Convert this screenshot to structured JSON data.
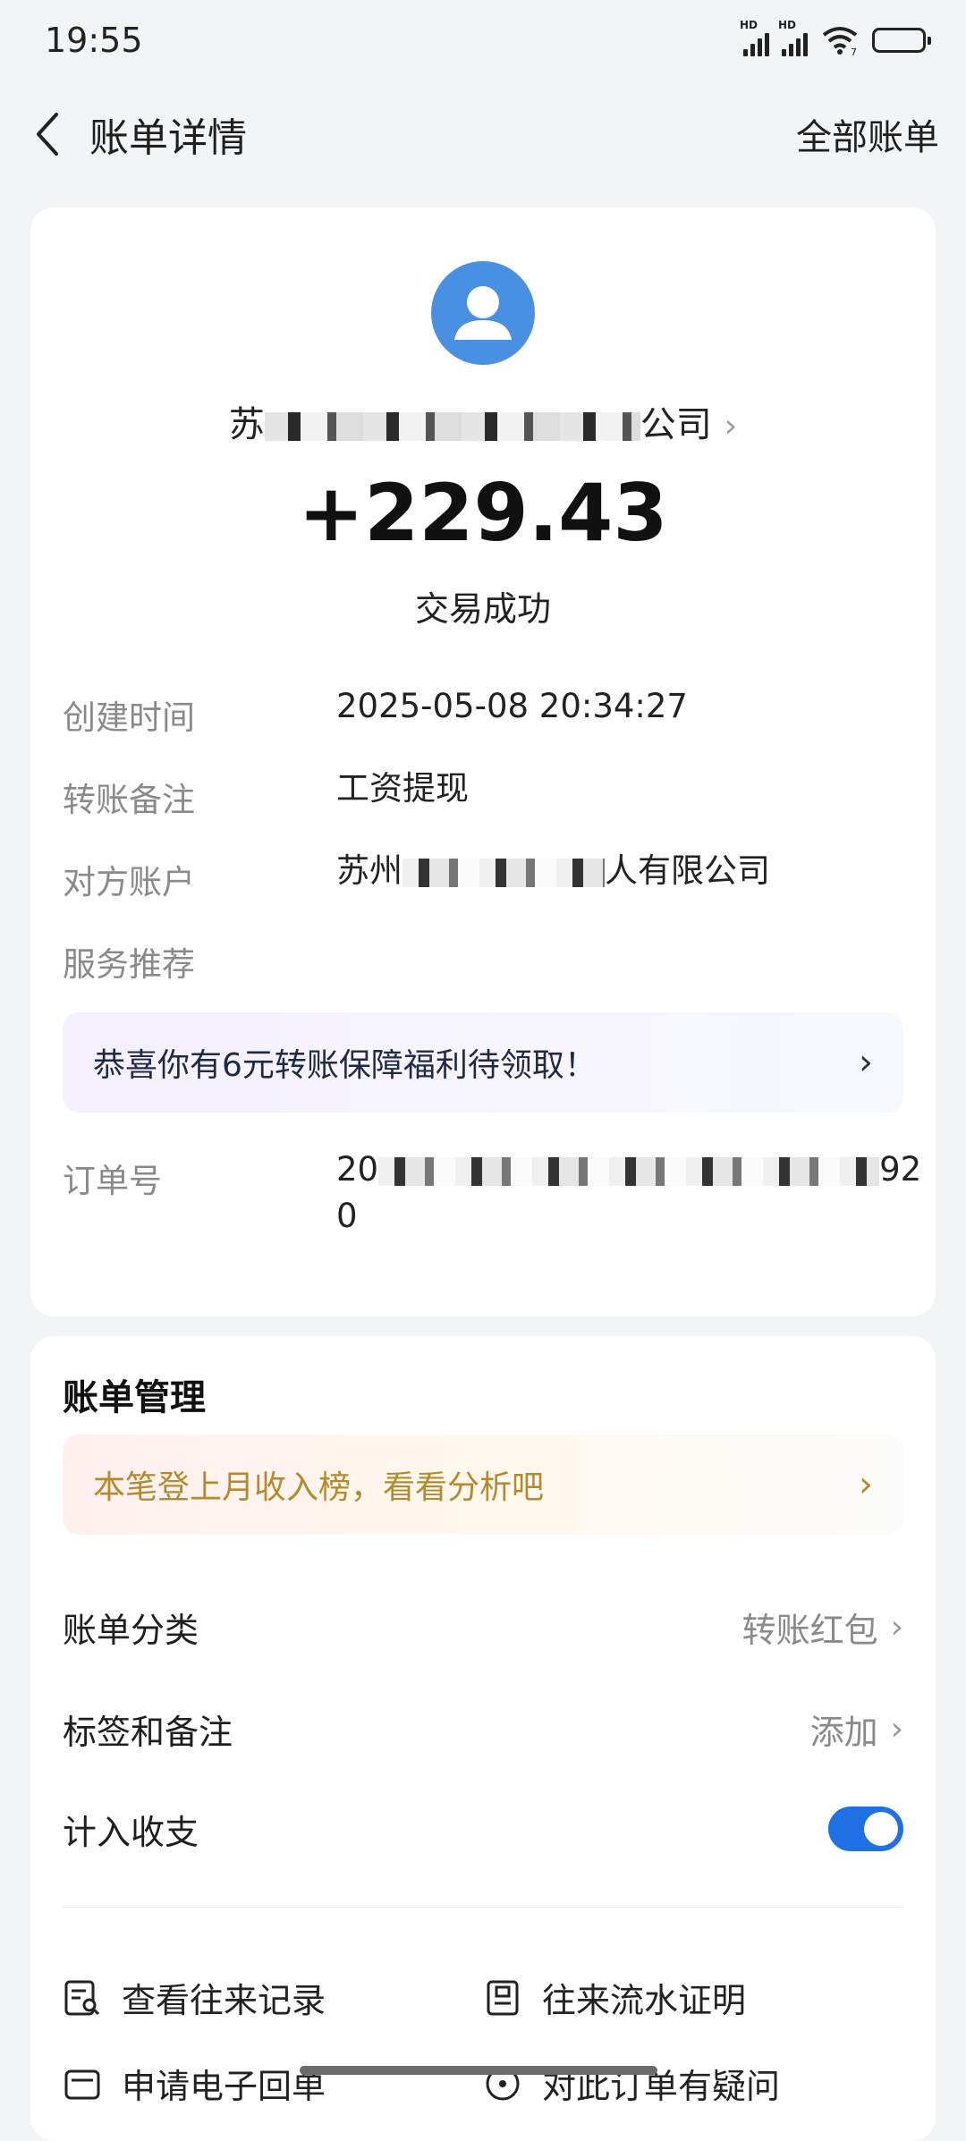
{
  "status_bar": {
    "time": "19:55",
    "signal1_label": "HD",
    "signal2_label": "HD",
    "wifi_badge": "7"
  },
  "nav": {
    "title": "账单详情",
    "right_link": "全部账单"
  },
  "transaction": {
    "counterparty_prefix": "苏",
    "counterparty_suffix": "公司",
    "amount": "+229.43",
    "status": "交易成功"
  },
  "details": [
    {
      "label": "创建时间",
      "value": "2025-05-08 20:34:27"
    },
    {
      "label": "转账备注",
      "value": "工资提现"
    },
    {
      "label": "对方账户",
      "value_prefix": "苏州",
      "value_suffix": "人有限公司"
    },
    {
      "label": "服务推荐"
    }
  ],
  "promo_banner": {
    "text": "恭喜你有6元转账保障福利待领取！"
  },
  "order": {
    "label": "订单号",
    "value_prefix": "20",
    "value_suffix": "92",
    "value_line2": "0"
  },
  "management": {
    "title": "账单管理",
    "banner_text": "本笔登上月收入榜，看看分析吧",
    "rows": [
      {
        "label": "账单分类",
        "value": "转账红包"
      },
      {
        "label": "标签和备注",
        "value": "添加"
      },
      {
        "label": "计入收支"
      }
    ],
    "actions": [
      {
        "label": "查看往来记录"
      },
      {
        "label": "往来流水证明"
      },
      {
        "label": "申请电子回单"
      },
      {
        "label": "对此订单有疑问"
      }
    ]
  },
  "colors": {
    "accent": "#1f6fe5",
    "avatar": "#4a90e2",
    "banner_gold": "#b48a2c"
  }
}
